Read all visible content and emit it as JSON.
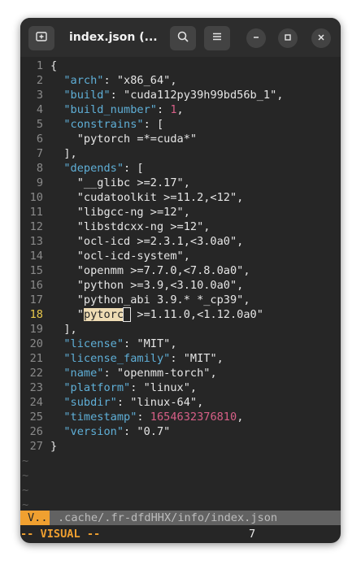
{
  "window": {
    "title": "index.json (...",
    "new_tab_icon": "new-tab-icon",
    "search_icon": "search-icon",
    "menu_icon": "hamburger-menu-icon",
    "minimize_icon": "minimize-icon",
    "maximize_icon": "maximize-icon",
    "close_icon": "close-icon"
  },
  "editor": {
    "current_line": 18,
    "lines": [
      {
        "n": "1",
        "segs": [
          [
            "p",
            "{"
          ]
        ]
      },
      {
        "n": "2",
        "segs": [
          [
            "p",
            "  "
          ],
          [
            "k",
            "\"arch\""
          ],
          [
            "p",
            ": "
          ],
          [
            "s",
            "\"x86_64\""
          ],
          [
            "p",
            ","
          ]
        ]
      },
      {
        "n": "3",
        "segs": [
          [
            "p",
            "  "
          ],
          [
            "k",
            "\"build\""
          ],
          [
            "p",
            ": "
          ],
          [
            "s",
            "\"cuda112py39h99bd56b_1\""
          ],
          [
            "p",
            ","
          ]
        ]
      },
      {
        "n": "4",
        "segs": [
          [
            "p",
            "  "
          ],
          [
            "k",
            "\"build_number\""
          ],
          [
            "p",
            ": "
          ],
          [
            "n",
            "1"
          ],
          [
            "p",
            ","
          ]
        ]
      },
      {
        "n": "5",
        "segs": [
          [
            "p",
            "  "
          ],
          [
            "k",
            "\"constrains\""
          ],
          [
            "p",
            ": ["
          ]
        ]
      },
      {
        "n": "6",
        "segs": [
          [
            "p",
            "    "
          ],
          [
            "s",
            "\"pytorch =*=cuda*\""
          ]
        ]
      },
      {
        "n": "7",
        "segs": [
          [
            "p",
            "  ],"
          ]
        ]
      },
      {
        "n": "8",
        "segs": [
          [
            "p",
            "  "
          ],
          [
            "k",
            "\"depends\""
          ],
          [
            "p",
            ": ["
          ]
        ]
      },
      {
        "n": "9",
        "segs": [
          [
            "p",
            "    "
          ],
          [
            "s",
            "\"__glibc >=2.17\""
          ],
          [
            "p",
            ","
          ]
        ]
      },
      {
        "n": "10",
        "segs": [
          [
            "p",
            "    "
          ],
          [
            "s",
            "\"cudatoolkit >=11.2,<12\""
          ],
          [
            "p",
            ","
          ]
        ]
      },
      {
        "n": "11",
        "segs": [
          [
            "p",
            "    "
          ],
          [
            "s",
            "\"libgcc-ng >=12\""
          ],
          [
            "p",
            ","
          ]
        ]
      },
      {
        "n": "12",
        "segs": [
          [
            "p",
            "    "
          ],
          [
            "s",
            "\"libstdcxx-ng >=12\""
          ],
          [
            "p",
            ","
          ]
        ]
      },
      {
        "n": "13",
        "segs": [
          [
            "p",
            "    "
          ],
          [
            "s",
            "\"ocl-icd >=2.3.1,<3.0a0\""
          ],
          [
            "p",
            ","
          ]
        ]
      },
      {
        "n": "14",
        "segs": [
          [
            "p",
            "    "
          ],
          [
            "s",
            "\"ocl-icd-system\""
          ],
          [
            "p",
            ","
          ]
        ]
      },
      {
        "n": "15",
        "segs": [
          [
            "p",
            "    "
          ],
          [
            "s",
            "\"openmm >=7.7.0,<7.8.0a0\""
          ],
          [
            "p",
            ","
          ]
        ]
      },
      {
        "n": "16",
        "segs": [
          [
            "p",
            "    "
          ],
          [
            "s",
            "\"python >=3.9,<3.10.0a0\""
          ],
          [
            "p",
            ","
          ]
        ]
      },
      {
        "n": "17",
        "segs": [
          [
            "p",
            "    "
          ],
          [
            "s",
            "\"python_abi 3.9.* *_cp39\""
          ],
          [
            "p",
            ","
          ]
        ]
      },
      {
        "n": "18",
        "segs": [
          [
            "p",
            "    "
          ],
          [
            "s",
            "\""
          ],
          [
            "sel",
            "pytorc"
          ],
          [
            "cursor",
            "h"
          ],
          [
            "s",
            " >=1.11.0,<1.12.0a0\""
          ]
        ]
      },
      {
        "n": "19",
        "segs": [
          [
            "p",
            "  ],"
          ]
        ]
      },
      {
        "n": "20",
        "segs": [
          [
            "p",
            "  "
          ],
          [
            "k",
            "\"license\""
          ],
          [
            "p",
            ": "
          ],
          [
            "s",
            "\"MIT\""
          ],
          [
            "p",
            ","
          ]
        ]
      },
      {
        "n": "21",
        "segs": [
          [
            "p",
            "  "
          ],
          [
            "k",
            "\"license_family\""
          ],
          [
            "p",
            ": "
          ],
          [
            "s",
            "\"MIT\""
          ],
          [
            "p",
            ","
          ]
        ]
      },
      {
        "n": "22",
        "segs": [
          [
            "p",
            "  "
          ],
          [
            "k",
            "\"name\""
          ],
          [
            "p",
            ": "
          ],
          [
            "s",
            "\"openmm-torch\""
          ],
          [
            "p",
            ","
          ]
        ]
      },
      {
        "n": "23",
        "segs": [
          [
            "p",
            "  "
          ],
          [
            "k",
            "\"platform\""
          ],
          [
            "p",
            ": "
          ],
          [
            "s",
            "\"linux\""
          ],
          [
            "p",
            ","
          ]
        ]
      },
      {
        "n": "24",
        "segs": [
          [
            "p",
            "  "
          ],
          [
            "k",
            "\"subdir\""
          ],
          [
            "p",
            ": "
          ],
          [
            "s",
            "\"linux-64\""
          ],
          [
            "p",
            ","
          ]
        ]
      },
      {
        "n": "25",
        "segs": [
          [
            "p",
            "  "
          ],
          [
            "k",
            "\"timestamp\""
          ],
          [
            "p",
            ": "
          ],
          [
            "n",
            "1654632376810"
          ],
          [
            "p",
            ","
          ]
        ]
      },
      {
        "n": "26",
        "segs": [
          [
            "p",
            "  "
          ],
          [
            "k",
            "\"version\""
          ],
          [
            "p",
            ": "
          ],
          [
            "s",
            "\"0.7\""
          ]
        ]
      },
      {
        "n": "27",
        "segs": [
          [
            "p",
            "}"
          ]
        ]
      }
    ],
    "empty_markers": [
      "~",
      "~",
      "~",
      "~"
    ]
  },
  "statusline": {
    "mode_short": "V..",
    "file_path": ".cache/.fr-dfdHHX/info/index.json"
  },
  "cmdline": {
    "mode_text": "-- VISUAL --",
    "selection_count": "7"
  },
  "colors": {
    "background": "#262626",
    "keyword": "#5fafd7",
    "number": "#d75f87",
    "selection": "#eedcb4",
    "mode_accent": "#f0a030",
    "current_line_number": "#e8c84c"
  }
}
